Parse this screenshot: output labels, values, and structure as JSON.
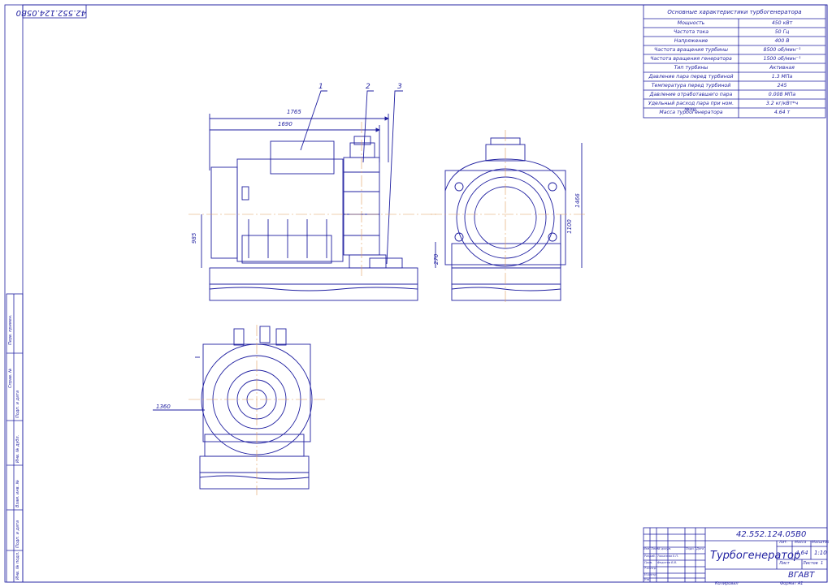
{
  "document_code": "42.552.124.05В0",
  "document_code_rotated": "42.552.124.05В0",
  "specs": {
    "title": "Основные характеристики турбогенератора",
    "rows": [
      {
        "name": "Мощность",
        "value": "450 кВт"
      },
      {
        "name": "Частота тока",
        "value": "50 Гц"
      },
      {
        "name": "Напряжение",
        "value": "400 В"
      },
      {
        "name": "Частота вращения турбины",
        "value": "8500 об/мин⁻¹"
      },
      {
        "name": "Частота вращения генератора",
        "value": "1500 об/мин⁻¹"
      },
      {
        "name": "Тип турбины",
        "value": "Активная"
      },
      {
        "name": "Давление пара перед турбиной",
        "value": "1.3 МПа"
      },
      {
        "name": "Температура перед турбиной",
        "value": "245"
      },
      {
        "name": "Давление отработавшего пара",
        "value": "0.008 МПа"
      },
      {
        "name": "Удельный расход пара при ном. мощ.",
        "value": "3.2 кг/кВт*ч"
      },
      {
        "name": "Масса турбогенератора",
        "value": "4.64 т"
      }
    ]
  },
  "callouts": [
    "1",
    "2",
    "3"
  ],
  "dimensions": {
    "overall_length": "1765",
    "frame_length": "1690",
    "shaft_height": "985",
    "total_height": "1466",
    "side_height": "1100",
    "base_height": "270",
    "plan_width": "1360"
  },
  "title_block": {
    "title": "Турбогенератор",
    "organization": "ВГАВТ",
    "mass_header": "Масса",
    "scale_header": "Масштаб",
    "letter_header": "Лит.",
    "mass": "4.64",
    "scale": "1:10",
    "sheet_label": "Лист",
    "sheets_label": "Листов",
    "sheets_count": "1",
    "copied": "Копировал",
    "format": "Формат А1",
    "col_headers": [
      "Изм.",
      "Лист",
      "№ докум.",
      "Подп.",
      "Дата"
    ],
    "roles": [
      "Разраб.",
      "Пров.",
      "Т.контр.",
      "Н.контр.",
      "Утв."
    ],
    "names": [
      "Тюкалова Е.П.",
      "Федотов В.В."
    ]
  },
  "side_stamps": [
    "Инв. № подл.",
    "Подп. и дата",
    "Взам. инв. №",
    "Инв. № дубл.",
    "Подп. и дата",
    "Справ. №",
    "Перв. примен."
  ]
}
